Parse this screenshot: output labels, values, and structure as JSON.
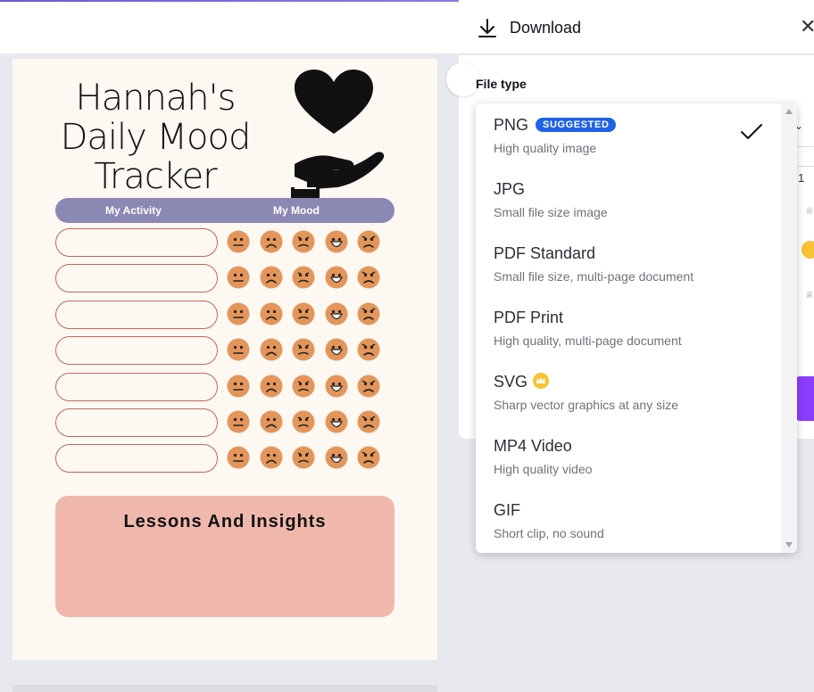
{
  "design": {
    "title_lines": [
      "Hannah's",
      "Daily Mood",
      "Tracker"
    ],
    "header_activity": "My Activity",
    "header_mood": "My Mood",
    "row_count": 7,
    "mood_faces": [
      "neutral-face-icon",
      "sad-face-icon",
      "frown-face-icon",
      "happy-face-icon",
      "angry-face-icon"
    ],
    "lessons_title": "Lessons And Insights",
    "colors": {
      "band": "#8b88b3",
      "face": "#e4955a",
      "lessons": "#f0b8ad",
      "pill_border": "#c0685a"
    }
  },
  "download": {
    "title": "Download",
    "file_type_label": "File type",
    "peek_value": "1",
    "options": [
      {
        "name": "PNG",
        "desc": "High quality image",
        "badge": "SUGGESTED",
        "selected": true
      },
      {
        "name": "JPG",
        "desc": "Small file size image"
      },
      {
        "name": "PDF Standard",
        "desc": "Small file size, multi-page document"
      },
      {
        "name": "PDF Print",
        "desc": "High quality, multi-page document"
      },
      {
        "name": "SVG",
        "desc": "Sharp vector graphics at any size",
        "pro": true
      },
      {
        "name": "MP4 Video",
        "desc": "High quality video"
      },
      {
        "name": "GIF",
        "desc": "Short clip, no sound"
      }
    ],
    "colors": {
      "badge": "#1f62e8",
      "crown": "#f8c232",
      "accent": "#8b3dff"
    }
  }
}
